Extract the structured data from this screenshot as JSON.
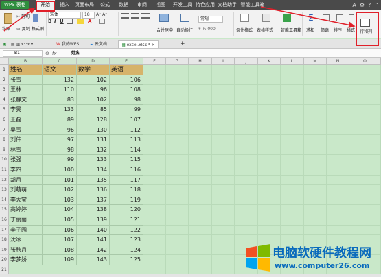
{
  "app": {
    "brand": "WPS 表格"
  },
  "menu": {
    "items": [
      {
        "label": "开始",
        "active": true
      },
      {
        "label": "插入"
      },
      {
        "label": "页面布局"
      },
      {
        "label": "公式"
      },
      {
        "label": "数据"
      },
      {
        "label": "审阅"
      },
      {
        "label": "视图"
      },
      {
        "label": "开发工具"
      },
      {
        "label": "特色应用"
      },
      {
        "label": "文档助手"
      },
      {
        "label": "智能工具箱"
      }
    ]
  },
  "ribbon": {
    "paste": "粘贴",
    "cut": "剪切",
    "copy": "复制",
    "format_painter": "格式刷",
    "font_name": "宋体",
    "font_size": "18",
    "bold": "B",
    "italic": "I",
    "underline": "U",
    "merge_center": "合并居中",
    "wrap_text": "自动换行",
    "number_format": "常规",
    "cond_format": "条件格式",
    "table_style": "表格样式",
    "smart_toolbox": "智能工具箱",
    "sum": "求和",
    "filter": "筛选",
    "sort": "排序",
    "fill": "格式",
    "row_col": "行和列"
  },
  "tabs": {
    "my_wps": "我的WPS",
    "cloud_doc": "云文档",
    "file": "excel.xlsx *",
    "add": "+"
  },
  "formula_bar": {
    "cell_ref": "B1",
    "fx": "fx",
    "value": "姓名"
  },
  "sheet": {
    "columns": [
      "B",
      "C",
      "D",
      "E",
      "F",
      "G",
      "H",
      "I",
      "J",
      "K",
      "L",
      "M",
      "N",
      "O"
    ],
    "headers": [
      "姓名",
      "语文",
      "数学",
      "英语"
    ],
    "rows": [
      [
        "张雪",
        "132",
        "102",
        "106"
      ],
      [
        "王林",
        "110",
        "96",
        "108"
      ],
      [
        "张静文",
        "83",
        "102",
        "98"
      ],
      [
        "李昊",
        "133",
        "85",
        "99"
      ],
      [
        "王磊",
        "89",
        "128",
        "107"
      ],
      [
        "吴雪",
        "96",
        "130",
        "112"
      ],
      [
        "刘伟",
        "97",
        "131",
        "113"
      ],
      [
        "林雪",
        "98",
        "132",
        "114"
      ],
      [
        "张强",
        "99",
        "133",
        "115"
      ],
      [
        "李四",
        "100",
        "134",
        "116"
      ],
      [
        "胡月",
        "101",
        "135",
        "117"
      ],
      [
        "刘萌萌",
        "102",
        "136",
        "118"
      ],
      [
        "李大宝",
        "103",
        "137",
        "119"
      ],
      [
        "高婷婷",
        "104",
        "138",
        "120"
      ],
      [
        "丁丽丽",
        "105",
        "139",
        "121"
      ],
      [
        "李子园",
        "106",
        "140",
        "122"
      ],
      [
        "沈冰",
        "107",
        "141",
        "123"
      ],
      [
        "张秋月",
        "108",
        "142",
        "124"
      ],
      [
        "李梦娇",
        "109",
        "143",
        "125"
      ]
    ],
    "row_numbers": [
      "1",
      "2",
      "3",
      "4",
      "5",
      "6",
      "7",
      "8",
      "9",
      "10",
      "11",
      "12",
      "13",
      "14",
      "15",
      "16",
      "17",
      "18",
      "19",
      "20",
      "21"
    ]
  },
  "watermark": {
    "title": "电脑软硬件教程网",
    "url": "www.computer26.com"
  },
  "colors": {
    "sheet_bg": "#c9e8c9",
    "header_fill": "#d6b36a",
    "accent_red": "#e0202a",
    "brand_green": "#2f8f3e",
    "watermark_blue": "#0a6bbd"
  }
}
